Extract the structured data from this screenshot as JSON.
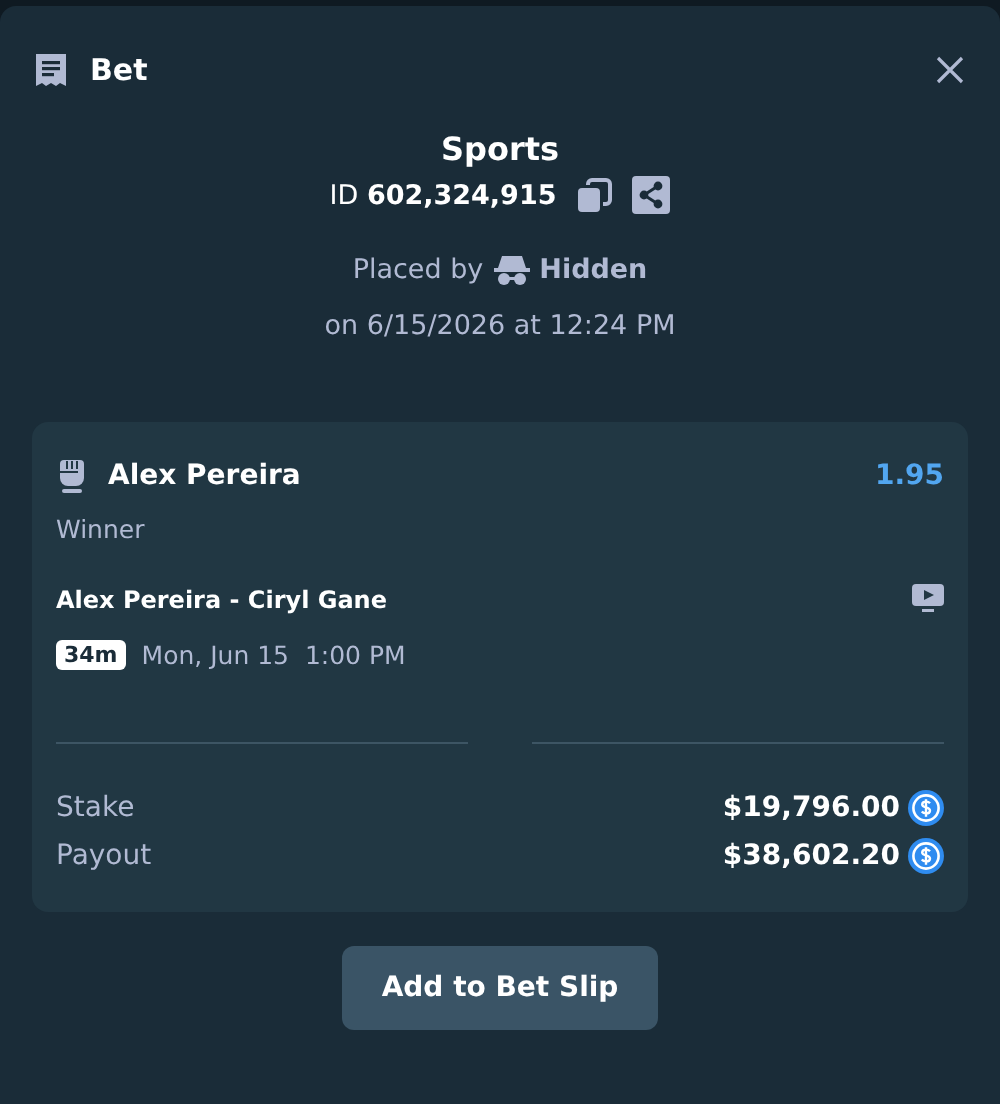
{
  "header": {
    "title": "Bet"
  },
  "summary": {
    "category": "Sports",
    "bet_id": "ID **602,324,915**",
    "placed_by_label": "Placed by",
    "placed_by_user": "Hidden",
    "placed_on": "on 6/15/2026 at 12:24 PM"
  },
  "selection": {
    "name": "Alex Pereira",
    "odds": "1.95",
    "market": "Winner",
    "event": "Alex Pereira - Ciryl Gane",
    "countdown": "34m",
    "start_time": "Mon, Jun 15  1:00 PM",
    "live_stream": true
  },
  "totals": [
    {
      "label": "Stake",
      "amount": "$19,796.00"
    },
    {
      "label": "Payout",
      "amount": "$38,602.20"
    }
  ],
  "button": "Add to Bet Slip"
}
